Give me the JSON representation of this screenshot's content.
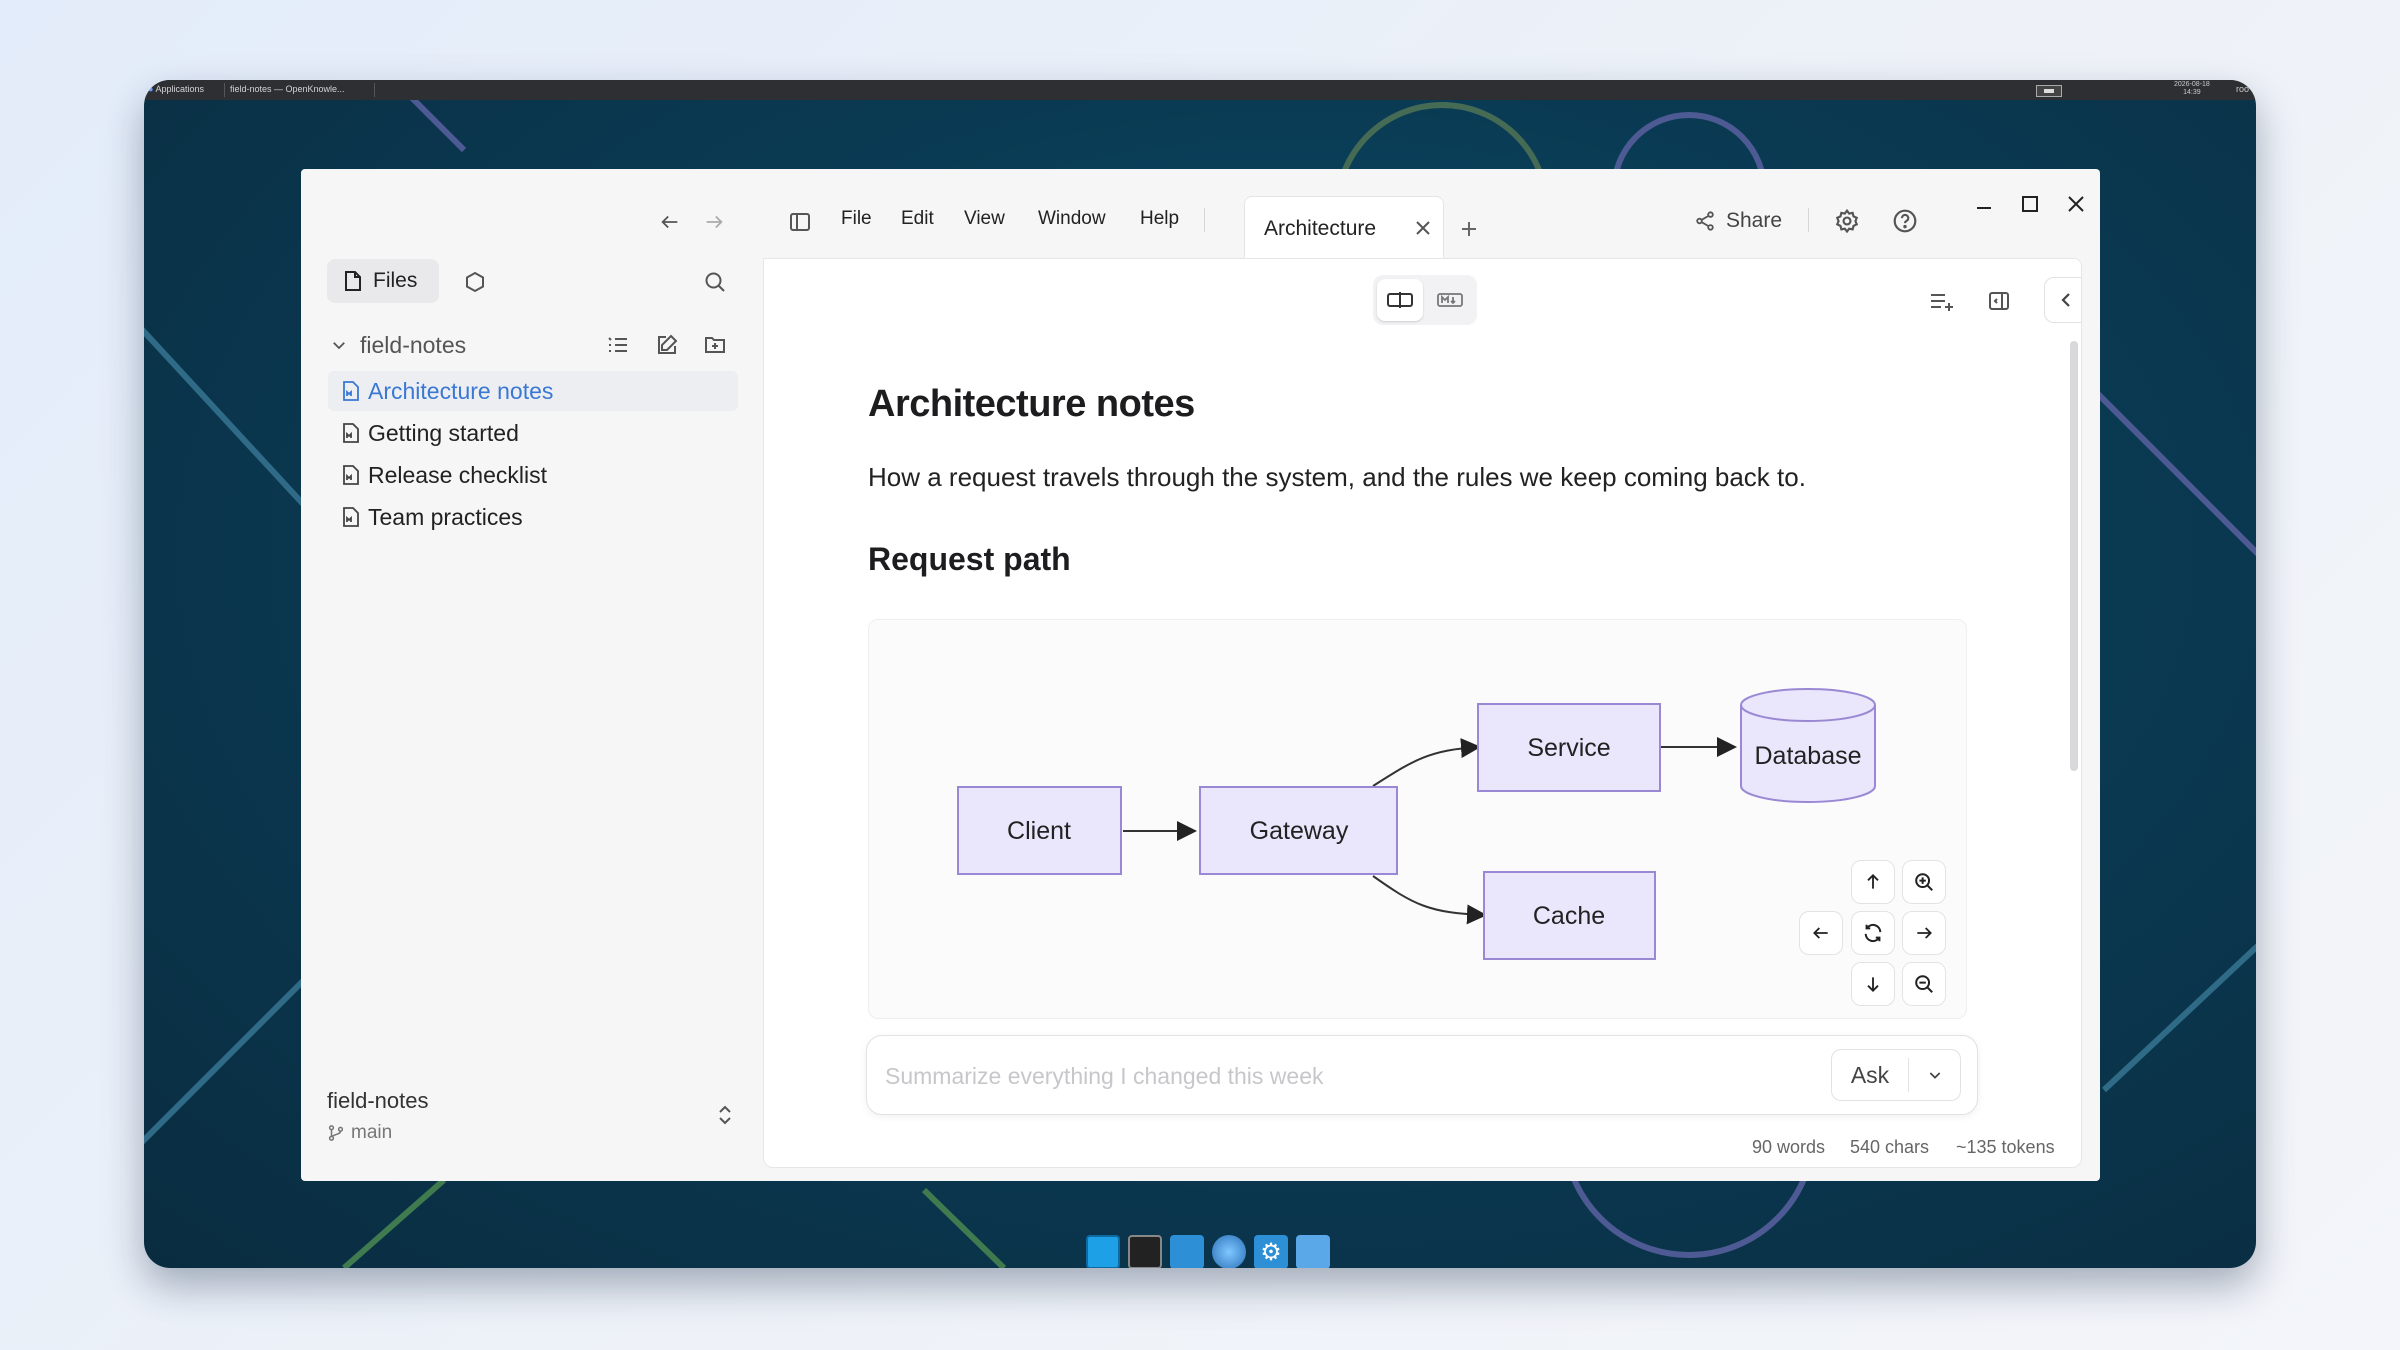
{
  "topbar": {
    "applications_label": "Applications",
    "window_title": "field-notes — OpenKnowle...",
    "clock_date": "2026-08-18",
    "clock_time": "14:39",
    "user": "roo"
  },
  "window": {
    "title": "field-notes"
  },
  "sidebar": {
    "files_tab": "Files",
    "folder_name": "field-notes",
    "items": [
      {
        "label": "Architecture notes",
        "active": true
      },
      {
        "label": "Getting started",
        "active": false
      },
      {
        "label": "Release checklist",
        "active": false
      },
      {
        "label": "Team practices",
        "active": false
      }
    ],
    "workspace_name": "field-notes",
    "branch": "main"
  },
  "menu": {
    "file": "File",
    "edit": "Edit",
    "view": "View",
    "window": "Window",
    "help": "Help"
  },
  "tabs": [
    {
      "label": "Architecture"
    }
  ],
  "header": {
    "share_label": "Share"
  },
  "document": {
    "title": "Architecture notes",
    "intro": "How a request travels through the system, and the rules we keep coming back to.",
    "section_heading": "Request path"
  },
  "diagram": {
    "nodes": {
      "client": "Client",
      "gateway": "Gateway",
      "service": "Service",
      "cache": "Cache",
      "database": "Database"
    },
    "edges": [
      [
        "Client",
        "Gateway"
      ],
      [
        "Gateway",
        "Service"
      ],
      [
        "Gateway",
        "Cache"
      ],
      [
        "Service",
        "Database"
      ]
    ]
  },
  "ask": {
    "placeholder": "Summarize everything I changed this week",
    "button": "Ask"
  },
  "stats": {
    "words": "90 words",
    "chars": "540 chars",
    "tokens": "~135 tokens"
  },
  "colors": {
    "accent": "#3a78d4",
    "node_fill": "#eae6fb",
    "node_stroke": "#9a88d4",
    "desktop_bg": "#0a3b54"
  }
}
